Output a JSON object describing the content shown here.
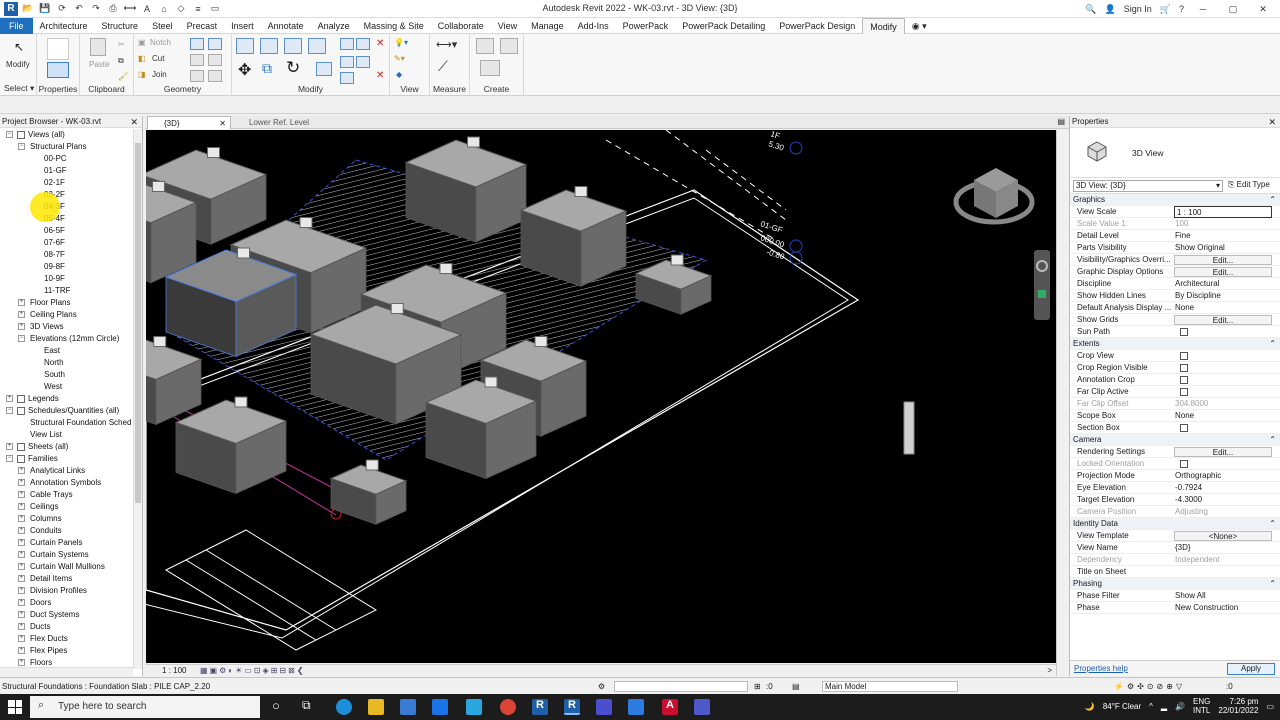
{
  "window": {
    "title": "Autodesk Revit 2022 - WK-03.rvt - 3D View: {3D}",
    "sign_in": "Sign In",
    "help": "?"
  },
  "ribbon_tabs": [
    {
      "label": "File"
    },
    {
      "label": "Architecture"
    },
    {
      "label": "Structure"
    },
    {
      "label": "Steel"
    },
    {
      "label": "Precast"
    },
    {
      "label": "Insert"
    },
    {
      "label": "Annotate"
    },
    {
      "label": "Analyze"
    },
    {
      "label": "Massing & Site"
    },
    {
      "label": "Collaborate"
    },
    {
      "label": "View"
    },
    {
      "label": "Manage"
    },
    {
      "label": "Add-Ins"
    },
    {
      "label": "PowerPack"
    },
    {
      "label": "PowerPack Detailing"
    },
    {
      "label": "PowerPack Design"
    },
    {
      "label": "Modify"
    }
  ],
  "ribbon": {
    "modify_label": "Modify",
    "notch": "Notch",
    "paste": "Paste",
    "cut": "Cut",
    "join": "Join",
    "groups": {
      "select": "Select",
      "properties": "Properties",
      "clipboard": "Clipboard",
      "geometry": "Geometry",
      "modify": "Modify",
      "view": "View",
      "measure": "Measure",
      "create": "Create"
    }
  },
  "project_browser": {
    "title": "Project Browser - WK-03.rvt",
    "items": [
      {
        "label": "Views (all)",
        "level": 0,
        "toggle": "−",
        "icon": true
      },
      {
        "label": "Structural Plans",
        "level": 1,
        "toggle": "−"
      },
      {
        "label": "00-PC",
        "level": 2
      },
      {
        "label": "01-GF",
        "level": 2
      },
      {
        "label": "02-1F",
        "level": 2
      },
      {
        "label": "03-2F",
        "level": 2
      },
      {
        "label": "04-3F",
        "level": 2
      },
      {
        "label": "05-4F",
        "level": 2
      },
      {
        "label": "06-5F",
        "level": 2
      },
      {
        "label": "07-6F",
        "level": 2
      },
      {
        "label": "08-7F",
        "level": 2
      },
      {
        "label": "09-8F",
        "level": 2
      },
      {
        "label": "10-9F",
        "level": 2
      },
      {
        "label": "11-TRF",
        "level": 2
      },
      {
        "label": "Floor Plans",
        "level": 1,
        "toggle": "+"
      },
      {
        "label": "Ceiling Plans",
        "level": 1,
        "toggle": "+"
      },
      {
        "label": "3D Views",
        "level": 1,
        "toggle": "+"
      },
      {
        "label": "Elevations (12mm Circle)",
        "level": 1,
        "toggle": "−"
      },
      {
        "label": "East",
        "level": 2
      },
      {
        "label": "North",
        "level": 2
      },
      {
        "label": "South",
        "level": 2
      },
      {
        "label": "West",
        "level": 2
      },
      {
        "label": "Legends",
        "level": 0,
        "toggle": "+",
        "icon": true
      },
      {
        "label": "Schedules/Quantities (all)",
        "level": 0,
        "toggle": "−",
        "icon": true
      },
      {
        "label": "Structural Foundation Sched",
        "level": 1
      },
      {
        "label": "View List",
        "level": 1
      },
      {
        "label": "Sheets (all)",
        "level": 0,
        "toggle": "+",
        "icon": true
      },
      {
        "label": "Families",
        "level": 0,
        "toggle": "−",
        "icon": true
      },
      {
        "label": "Analytical Links",
        "level": 1,
        "toggle": "+"
      },
      {
        "label": "Annotation Symbols",
        "level": 1,
        "toggle": "+"
      },
      {
        "label": "Cable Trays",
        "level": 1,
        "toggle": "+"
      },
      {
        "label": "Ceilings",
        "level": 1,
        "toggle": "+"
      },
      {
        "label": "Columns",
        "level": 1,
        "toggle": "+"
      },
      {
        "label": "Conduits",
        "level": 1,
        "toggle": "+"
      },
      {
        "label": "Curtain Panels",
        "level": 1,
        "toggle": "+"
      },
      {
        "label": "Curtain Systems",
        "level": 1,
        "toggle": "+"
      },
      {
        "label": "Curtain Wall Mullions",
        "level": 1,
        "toggle": "+"
      },
      {
        "label": "Detail Items",
        "level": 1,
        "toggle": "+"
      },
      {
        "label": "Division Profiles",
        "level": 1,
        "toggle": "+"
      },
      {
        "label": "Doors",
        "level": 1,
        "toggle": "+"
      },
      {
        "label": "Duct Systems",
        "level": 1,
        "toggle": "+"
      },
      {
        "label": "Ducts",
        "level": 1,
        "toggle": "+"
      },
      {
        "label": "Flex Ducts",
        "level": 1,
        "toggle": "+"
      },
      {
        "label": "Flex Pipes",
        "level": 1,
        "toggle": "+"
      },
      {
        "label": "Floors",
        "level": 1,
        "toggle": "+"
      }
    ]
  },
  "view_tabs": [
    {
      "label": "{3D}",
      "active": true
    },
    {
      "label": "Lower Ref. Level",
      "active": false
    }
  ],
  "viewport": {
    "level_labels": [
      "1F",
      "5.30",
      "01-GF",
      "000.00",
      "-0.80"
    ],
    "scale": "1 : 100"
  },
  "properties": {
    "title": "Properties",
    "type_name": "3D View",
    "type_selector": "3D View: {3D}",
    "edit_type": "Edit Type",
    "rows": [
      {
        "group": "Graphics"
      },
      {
        "k": "View Scale",
        "v": "1 : 100",
        "kind": "input"
      },
      {
        "k": "Scale Value    1:",
        "v": "100",
        "kind": "text",
        "dim": true
      },
      {
        "k": "Detail Level",
        "v": "Fine",
        "kind": "text"
      },
      {
        "k": "Parts Visibility",
        "v": "Show Original",
        "kind": "text"
      },
      {
        "k": "Visibility/Graphics Overri...",
        "v": "Edit...",
        "kind": "button"
      },
      {
        "k": "Graphic Display Options",
        "v": "Edit...",
        "kind": "button"
      },
      {
        "k": "Discipline",
        "v": "Architectural",
        "kind": "text"
      },
      {
        "k": "Show Hidden Lines",
        "v": "By Discipline",
        "kind": "text"
      },
      {
        "k": "Default Analysis Display ...",
        "v": "None",
        "kind": "text"
      },
      {
        "k": "Show Grids",
        "v": "Edit...",
        "kind": "button"
      },
      {
        "k": "Sun Path",
        "v": "",
        "kind": "check"
      },
      {
        "group": "Extents"
      },
      {
        "k": "Crop View",
        "v": "",
        "kind": "check"
      },
      {
        "k": "Crop Region Visible",
        "v": "",
        "kind": "check"
      },
      {
        "k": "Annotation Crop",
        "v": "",
        "kind": "check"
      },
      {
        "k": "Far Clip Active",
        "v": "",
        "kind": "check"
      },
      {
        "k": "Far Clip Offset",
        "v": "304.8000",
        "kind": "text",
        "dim": true
      },
      {
        "k": "Scope Box",
        "v": "None",
        "kind": "text"
      },
      {
        "k": "Section Box",
        "v": "",
        "kind": "check"
      },
      {
        "group": "Camera"
      },
      {
        "k": "Rendering Settings",
        "v": "Edit...",
        "kind": "button"
      },
      {
        "k": "Locked Orientation",
        "v": "",
        "kind": "check",
        "dim": true
      },
      {
        "k": "Projection Mode",
        "v": "Orthographic",
        "kind": "text"
      },
      {
        "k": "Eye Elevation",
        "v": "-0.7924",
        "kind": "text"
      },
      {
        "k": "Target Elevation",
        "v": "-4.3000",
        "kind": "text"
      },
      {
        "k": "Camera Position",
        "v": "Adjusting",
        "kind": "text",
        "dim": true
      },
      {
        "group": "Identity Data"
      },
      {
        "k": "View Template",
        "v": "<None>",
        "kind": "button"
      },
      {
        "k": "View Name",
        "v": "{3D}",
        "kind": "text"
      },
      {
        "k": "Dependency",
        "v": "Independent",
        "kind": "text",
        "dim": true
      },
      {
        "k": "Title on Sheet",
        "v": "",
        "kind": "text"
      },
      {
        "group": "Phasing"
      },
      {
        "k": "Phase Filter",
        "v": "Show All",
        "kind": "text"
      },
      {
        "k": "Phase",
        "v": "New Construction",
        "kind": "text"
      }
    ],
    "help_link": "Properties help",
    "apply": "Apply"
  },
  "statusbar": {
    "text": "Structural Foundations : Foundation Slab : PILE CAP_2.20",
    "zero": ":0",
    "model": "Main Model",
    "zero2": ":0"
  },
  "taskbar": {
    "search_placeholder": "Type here to search",
    "weather": "84°F  Clear",
    "lang1": "ENG",
    "lang2": "INTL",
    "time": "7:26 pm",
    "date": "22/01/2022"
  },
  "colors": {
    "accent": "#1f6fbf",
    "viewport_bg": "#000000",
    "selected_box": "#4a7fe0"
  }
}
